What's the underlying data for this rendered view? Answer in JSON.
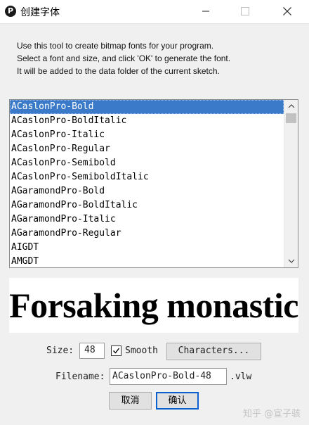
{
  "window": {
    "title": "创建字体",
    "icon": "processing-logo-icon",
    "icon_glyph": "P"
  },
  "instructions": [
    "Use this tool to create bitmap fonts for your program.",
    "Select a font and size, and click 'OK' to generate the font.",
    "It will be added to the data folder of the current sketch."
  ],
  "font_list": {
    "selected": "ACaslonPro-Bold",
    "items": [
      "ACaslonPro-Bold",
      "ACaslonPro-BoldItalic",
      "ACaslonPro-Italic",
      "ACaslonPro-Regular",
      "ACaslonPro-Semibold",
      "ACaslonPro-SemiboldItalic",
      "AGaramondPro-Bold",
      "AGaramondPro-BoldItalic",
      "AGaramondPro-Italic",
      "AGaramondPro-Regular",
      "AIGDT",
      "AMGDT"
    ]
  },
  "preview": {
    "text": "Forsaking monastic"
  },
  "controls": {
    "size_label": "Size:",
    "size_value": "48",
    "smooth_label": "Smooth",
    "smooth_checked": true,
    "characters_button": "Characters...",
    "filename_label": "Filename:",
    "filename_value": "ACaslonPro-Bold-48",
    "extension": ".vlw"
  },
  "buttons": {
    "cancel": "取消",
    "ok": "确认"
  },
  "watermark": "知乎 @宣子骇",
  "colors": {
    "selection": "#3b7ac8",
    "ok_border": "#0a5fd1",
    "dialog_bg": "#f0f0f0"
  }
}
